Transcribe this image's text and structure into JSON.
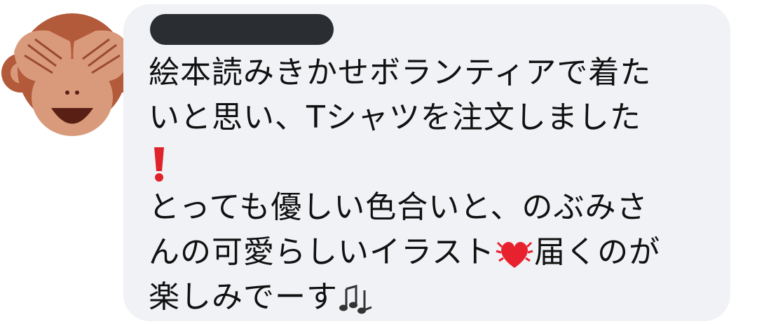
{
  "avatar": {
    "icon": "see-no-evil-monkey-icon"
  },
  "sender": {
    "name_redacted": true
  },
  "message": {
    "lines": [
      "絵本読みきかせボランティアで着た",
      "いと思い、Tシャツを注文しました",
      "",
      "とっても優しい色合いと、のぶみさ",
      "んの可愛らしいイラスト",
      "届くのが",
      "楽しみでーす"
    ],
    "emojis": [
      "exclamation-icon",
      "beating-heart-icon",
      "musical-notes-icon"
    ]
  },
  "colors": {
    "bubble": "#f0f2f5",
    "text": "#111111",
    "redaction": "#2a2d31",
    "monkey_fur": "#b35a3a",
    "monkey_face": "#d99a7c"
  }
}
